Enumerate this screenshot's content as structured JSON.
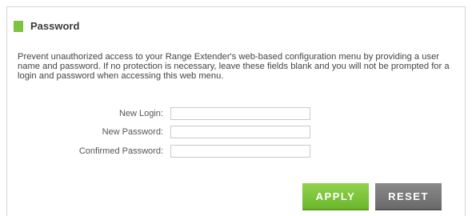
{
  "section": {
    "title": "Password",
    "accent_color": "#7dc240",
    "description": "Prevent unauthorized access to your Range Extender's web-based configuration menu by providing a user name and password. If no protection is necessary, leave these fields blank and you will not be prompted for a login and password when accessing this web menu."
  },
  "form": {
    "new_login": {
      "label": "New Login:",
      "value": ""
    },
    "new_password": {
      "label": "New Password:",
      "value": ""
    },
    "confirmed_password": {
      "label": "Confirmed Password:",
      "value": ""
    }
  },
  "buttons": {
    "apply_label": "APPLY",
    "apply_color": "#7dc240",
    "reset_label": "RESET",
    "reset_color": "#757575"
  }
}
